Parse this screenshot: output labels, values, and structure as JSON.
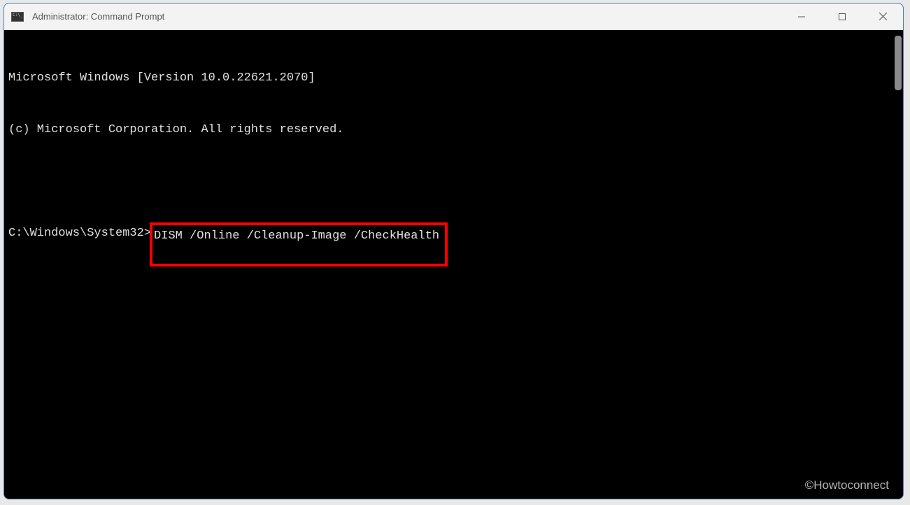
{
  "window": {
    "title": "Administrator: Command Prompt"
  },
  "terminal": {
    "line1": "Microsoft Windows [Version 10.0.22621.2070]",
    "line2": "(c) Microsoft Corporation. All rights reserved.",
    "prompt": "C:\\Windows\\System32>",
    "command": "DISM /Online /Cleanup-Image /CheckHealth"
  },
  "watermark": "©Howtoconnect"
}
